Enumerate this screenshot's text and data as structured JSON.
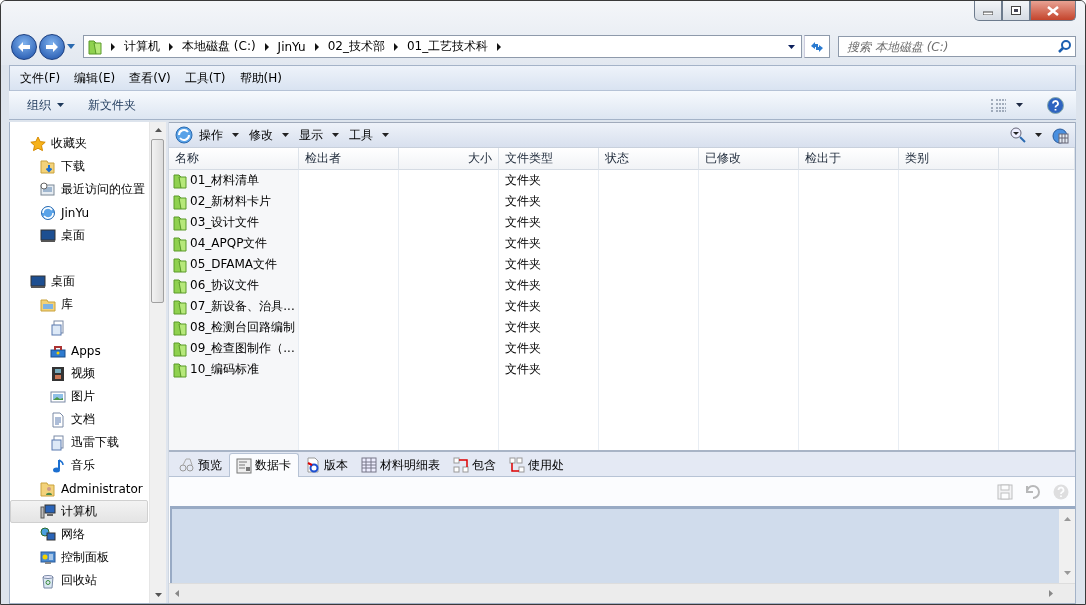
{
  "address_bar": {
    "segments": [
      "计算机",
      "本地磁盘 (C:)",
      "JinYu",
      "02_技术部",
      "01_工艺技术科"
    ]
  },
  "search": {
    "placeholder": "搜索 本地磁盘 (C:)"
  },
  "menu_bar": [
    "文件(F)",
    "编辑(E)",
    "查看(V)",
    "工具(T)",
    "帮助(H)"
  ],
  "command_bar": [
    {
      "label": "组织",
      "kind": "dropdown"
    },
    {
      "label": "新文件夹",
      "kind": "button"
    }
  ],
  "sidebar": {
    "items": [
      {
        "label": "收藏夹",
        "selected": false,
        "children": [
          {
            "label": "下载",
            "selected": false
          },
          {
            "label": "最近访问的位置",
            "selected": false
          },
          {
            "label": "JinYu",
            "selected": false
          },
          {
            "label": "桌面",
            "selected": false
          }
        ]
      },
      {
        "label": "桌面",
        "selected": false,
        "children": [
          {
            "label": "库",
            "selected": false,
            "children": [
              {
                "selected": false
              },
              {
                "label": "Apps",
                "selected": false
              },
              {
                "label": "视频",
                "selected": false
              },
              {
                "label": "图片",
                "selected": false
              },
              {
                "label": "文档",
                "selected": false
              },
              {
                "label": "迅雷下载",
                "selected": false
              },
              {
                "label": "音乐",
                "selected": false
              }
            ]
          },
          {
            "label": "Administrator",
            "selected": false
          },
          {
            "label": "计算机",
            "selected": true
          },
          {
            "label": "网络",
            "selected": false
          },
          {
            "label": "控制面板",
            "selected": false
          },
          {
            "label": "回收站",
            "selected": false
          }
        ]
      }
    ]
  },
  "pdm_toolbar": {
    "menus": [
      "操作",
      "修改",
      "显示",
      "工具"
    ]
  },
  "table": {
    "columns": [
      {
        "label": "名称",
        "kind": "text"
      },
      {
        "label": "检出者",
        "kind": "text"
      },
      {
        "label": "大小",
        "kind": "numeric"
      },
      {
        "label": "文件类型",
        "kind": "text"
      },
      {
        "label": "状态",
        "kind": "text"
      },
      {
        "label": "已修改",
        "kind": "text"
      },
      {
        "label": "检出于",
        "kind": "text"
      },
      {
        "label": "类别",
        "kind": "text"
      }
    ],
    "rows": [
      {
        "name": "01_材料清单",
        "file_type": "文件夹"
      },
      {
        "name": "02_新材料卡片",
        "file_type": "文件夹"
      },
      {
        "name": "03_设计文件",
        "file_type": "文件夹"
      },
      {
        "name": "04_APQP文件",
        "file_type": "文件夹"
      },
      {
        "name": "05_DFAMA文件",
        "file_type": "文件夹"
      },
      {
        "name": "06_协议文件",
        "file_type": "文件夹"
      },
      {
        "name": "07_新设备、治具...",
        "file_type": "文件夹"
      },
      {
        "name": "08_检测台回路编制",
        "file_type": "文件夹"
      },
      {
        "name": "09_检查图制作（...",
        "file_type": "文件夹"
      },
      {
        "name": "10_编码标准",
        "file_type": "文件夹"
      }
    ]
  },
  "card_tabs": [
    {
      "label": "预览",
      "selected": false
    },
    {
      "label": "数据卡",
      "selected": true
    },
    {
      "label": "版本",
      "selected": false
    },
    {
      "label": "材料明细表",
      "selected": false
    },
    {
      "label": "包含",
      "selected": false
    },
    {
      "label": "使用处",
      "selected": false
    }
  ],
  "card_toolbar": {
    "disabled": true
  }
}
